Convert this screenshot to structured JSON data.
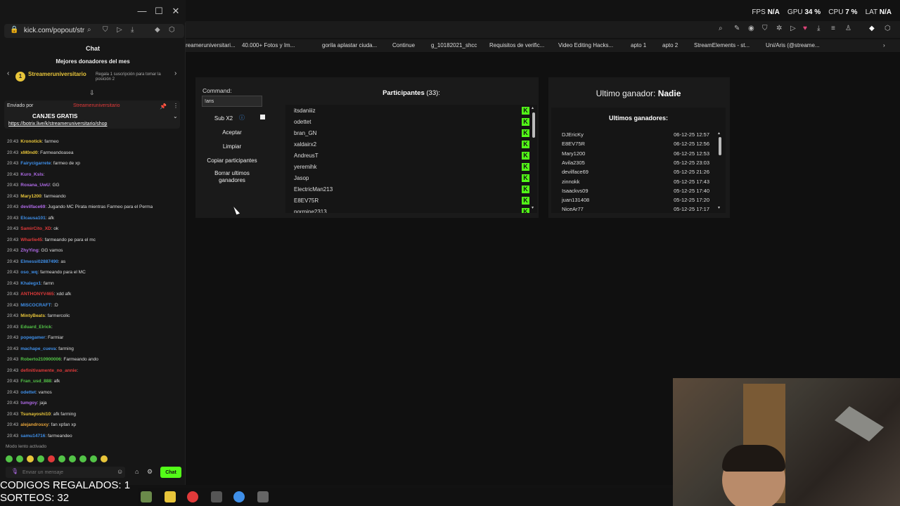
{
  "left_window": {
    "url": "kick.com/popout/str",
    "chat_title": "Chat",
    "donor_title": "Mejores donadores del mes",
    "donor_name": "Streameruniversitario",
    "donor_rank": "1",
    "donor_sub": "Regala 1 suscripción para tomar la posición 2",
    "pinned_by": "Enviado por",
    "pinned_user": "Streameruniversitario",
    "pinned_title": "CANJES GRATIS",
    "pinned_link": "https://botrix.live/k/streameruniversitario/shop",
    "messages": [
      {
        "time": "20:43",
        "user": "Kronotick",
        "color": "#e8c53a",
        "text": "farmeo"
      },
      {
        "time": "20:43",
        "user": "xM0nd0",
        "color": "#e8c53a",
        "text": "Farmeandoasea"
      },
      {
        "time": "20:43",
        "user": "Fairycigarrete",
        "color": "#3f8fe8",
        "text": "farmeo de xp"
      },
      {
        "time": "20:43",
        "user": "Kuro_Ksls",
        "color": "#b06be8",
        "text": ""
      },
      {
        "time": "20:43",
        "user": "Roxana_UwU",
        "color": "#b06be8",
        "text": "GG"
      },
      {
        "time": "20:43",
        "user": "Mary1200",
        "color": "#e8c53a",
        "text": "farmeando"
      },
      {
        "time": "20:43",
        "user": "devilface69",
        "color": "#b06be8",
        "text": "Jugando MC Pirata mientras Farmeo para el Perma"
      },
      {
        "time": "20:43",
        "user": "Elcausa101",
        "color": "#3f8fe8",
        "text": "afk"
      },
      {
        "time": "20:43",
        "user": "SamirCito_XD",
        "color": "#e03a3a",
        "text": "ok"
      },
      {
        "time": "20:43",
        "user": "Wharlie45",
        "color": "#e03a3a",
        "text": "farmeando pe para el mc"
      },
      {
        "time": "20:43",
        "user": "ZhyYing",
        "color": "#b06be8",
        "text": "GG vamos"
      },
      {
        "time": "20:43",
        "user": "Elmessi02887490",
        "color": "#3f8fe8",
        "text": "as"
      },
      {
        "time": "20:43",
        "user": "oso_wq",
        "color": "#3f8fe8",
        "text": "farmeando para el MC"
      },
      {
        "time": "20:43",
        "user": "Khalegx1",
        "color": "#3f8fe8",
        "text": "farnn"
      },
      {
        "time": "20:43",
        "user": "ANTHONYV465",
        "color": "#e03a3a",
        "text": "xdd afk"
      },
      {
        "time": "20:43",
        "user": "MISCOCRAFT",
        "color": "#3f8fe8",
        "text": ":D"
      },
      {
        "time": "20:43",
        "user": "MintyBeats",
        "color": "#e8c53a",
        "text": "farmercolic"
      },
      {
        "time": "20:43",
        "user": "Eduard_Elrick",
        "color": "#53c447",
        "text": ""
      },
      {
        "time": "20:43",
        "user": "popegamer",
        "color": "#3f8fe8",
        "text": "Farmiar"
      },
      {
        "time": "20:43",
        "user": "machape_cueva",
        "color": "#3f8fe8",
        "text": "farming"
      },
      {
        "time": "20:43",
        "user": "Roberto210900006",
        "color": "#53c447",
        "text": "Farmeando ando"
      },
      {
        "time": "20:43",
        "user": "definitivamente_no_annie",
        "color": "#e03a3a",
        "text": ""
      },
      {
        "time": "20:43",
        "user": "Fran_usd_888",
        "color": "#53c447",
        "text": "afk"
      },
      {
        "time": "20:43",
        "user": "odettet",
        "color": "#3f8fe8",
        "text": "vamos"
      },
      {
        "time": "20:43",
        "user": "tumgoy",
        "color": "#b06be8",
        "text": "jaja"
      },
      {
        "time": "20:43",
        "user": "Tsunayoshi10",
        "color": "#e8c53a",
        "text": "afk farming"
      },
      {
        "time": "20:43",
        "user": "alejandrosxy",
        "color": "#e8a53a",
        "text": "fan xpfan xp"
      },
      {
        "time": "20:43",
        "user": "samu14716",
        "color": "#3f8fe8",
        "text": "farmeandeo"
      }
    ],
    "slow_mode": "Modo lento activado",
    "input_placeholder": "Enviar un mensaje",
    "chat_button": "Chat"
  },
  "stats": {
    "fps_label": "FPS",
    "fps": "N/A",
    "gpu_label": "GPU",
    "gpu": "34 %",
    "cpu_label": "CPU",
    "cpu": "7 %",
    "lat_label": "LAT",
    "lat": "N/A"
  },
  "bookmarks": [
    "reameruniversitari...",
    "40.000+ Fotos y Im...",
    "gorila aplastar ciuda...",
    "Continue",
    "g_10182021_shcc",
    "Requisitos de verific...",
    "Video Editing Hacks...",
    "apto 1",
    "apto 2",
    "StreamElements - st...",
    "Uni/Aris (@streame..."
  ],
  "tool": {
    "command_label": "Command:",
    "command_value": "!aris",
    "sub_x2": "Sub X2",
    "accept": "Aceptar",
    "clear": "Limpiar",
    "copy": "Copiar participantes",
    "delete_winners": "Borrar ultimos ganadores",
    "participants_label": "Participantes",
    "participants_count": "(33):",
    "participants": [
      "itsdaniiiz",
      "odettet",
      "bran_GN",
      "xaldairx2",
      "AndreusT",
      "yeremihk",
      "Jasop",
      "ElectricMan213",
      "E8EV75R",
      "pormine2313"
    ]
  },
  "winners": {
    "last_label": "Ultimo ganador:",
    "last_value": "Nadie",
    "title": "Ultimos ganadores:",
    "list": [
      {
        "name": "DJEricKy",
        "date": "06-12-25 12:57"
      },
      {
        "name": "E8EV75R",
        "date": "06-12-25 12:56"
      },
      {
        "name": "Mary1200",
        "date": "06-12-25 12:53"
      },
      {
        "name": "Avila2305",
        "date": "05-12-25 23:03"
      },
      {
        "name": "devilface69",
        "date": "05-12-25 21:26"
      },
      {
        "name": "zinnokk",
        "date": "05-12-25 17:43"
      },
      {
        "name": "Isaackvs09",
        "date": "05-12-25 17:40"
      },
      {
        "name": "juan131408",
        "date": "05-12-25 17:20"
      },
      {
        "name": "NiceAr77",
        "date": "05-12-25 17:17"
      }
    ]
  },
  "overlay": {
    "codes": "CODIGOS REGALADOS: 1",
    "raffles": "SORTEOS: 32"
  },
  "colors": {
    "kick_green": "#53fc18"
  }
}
